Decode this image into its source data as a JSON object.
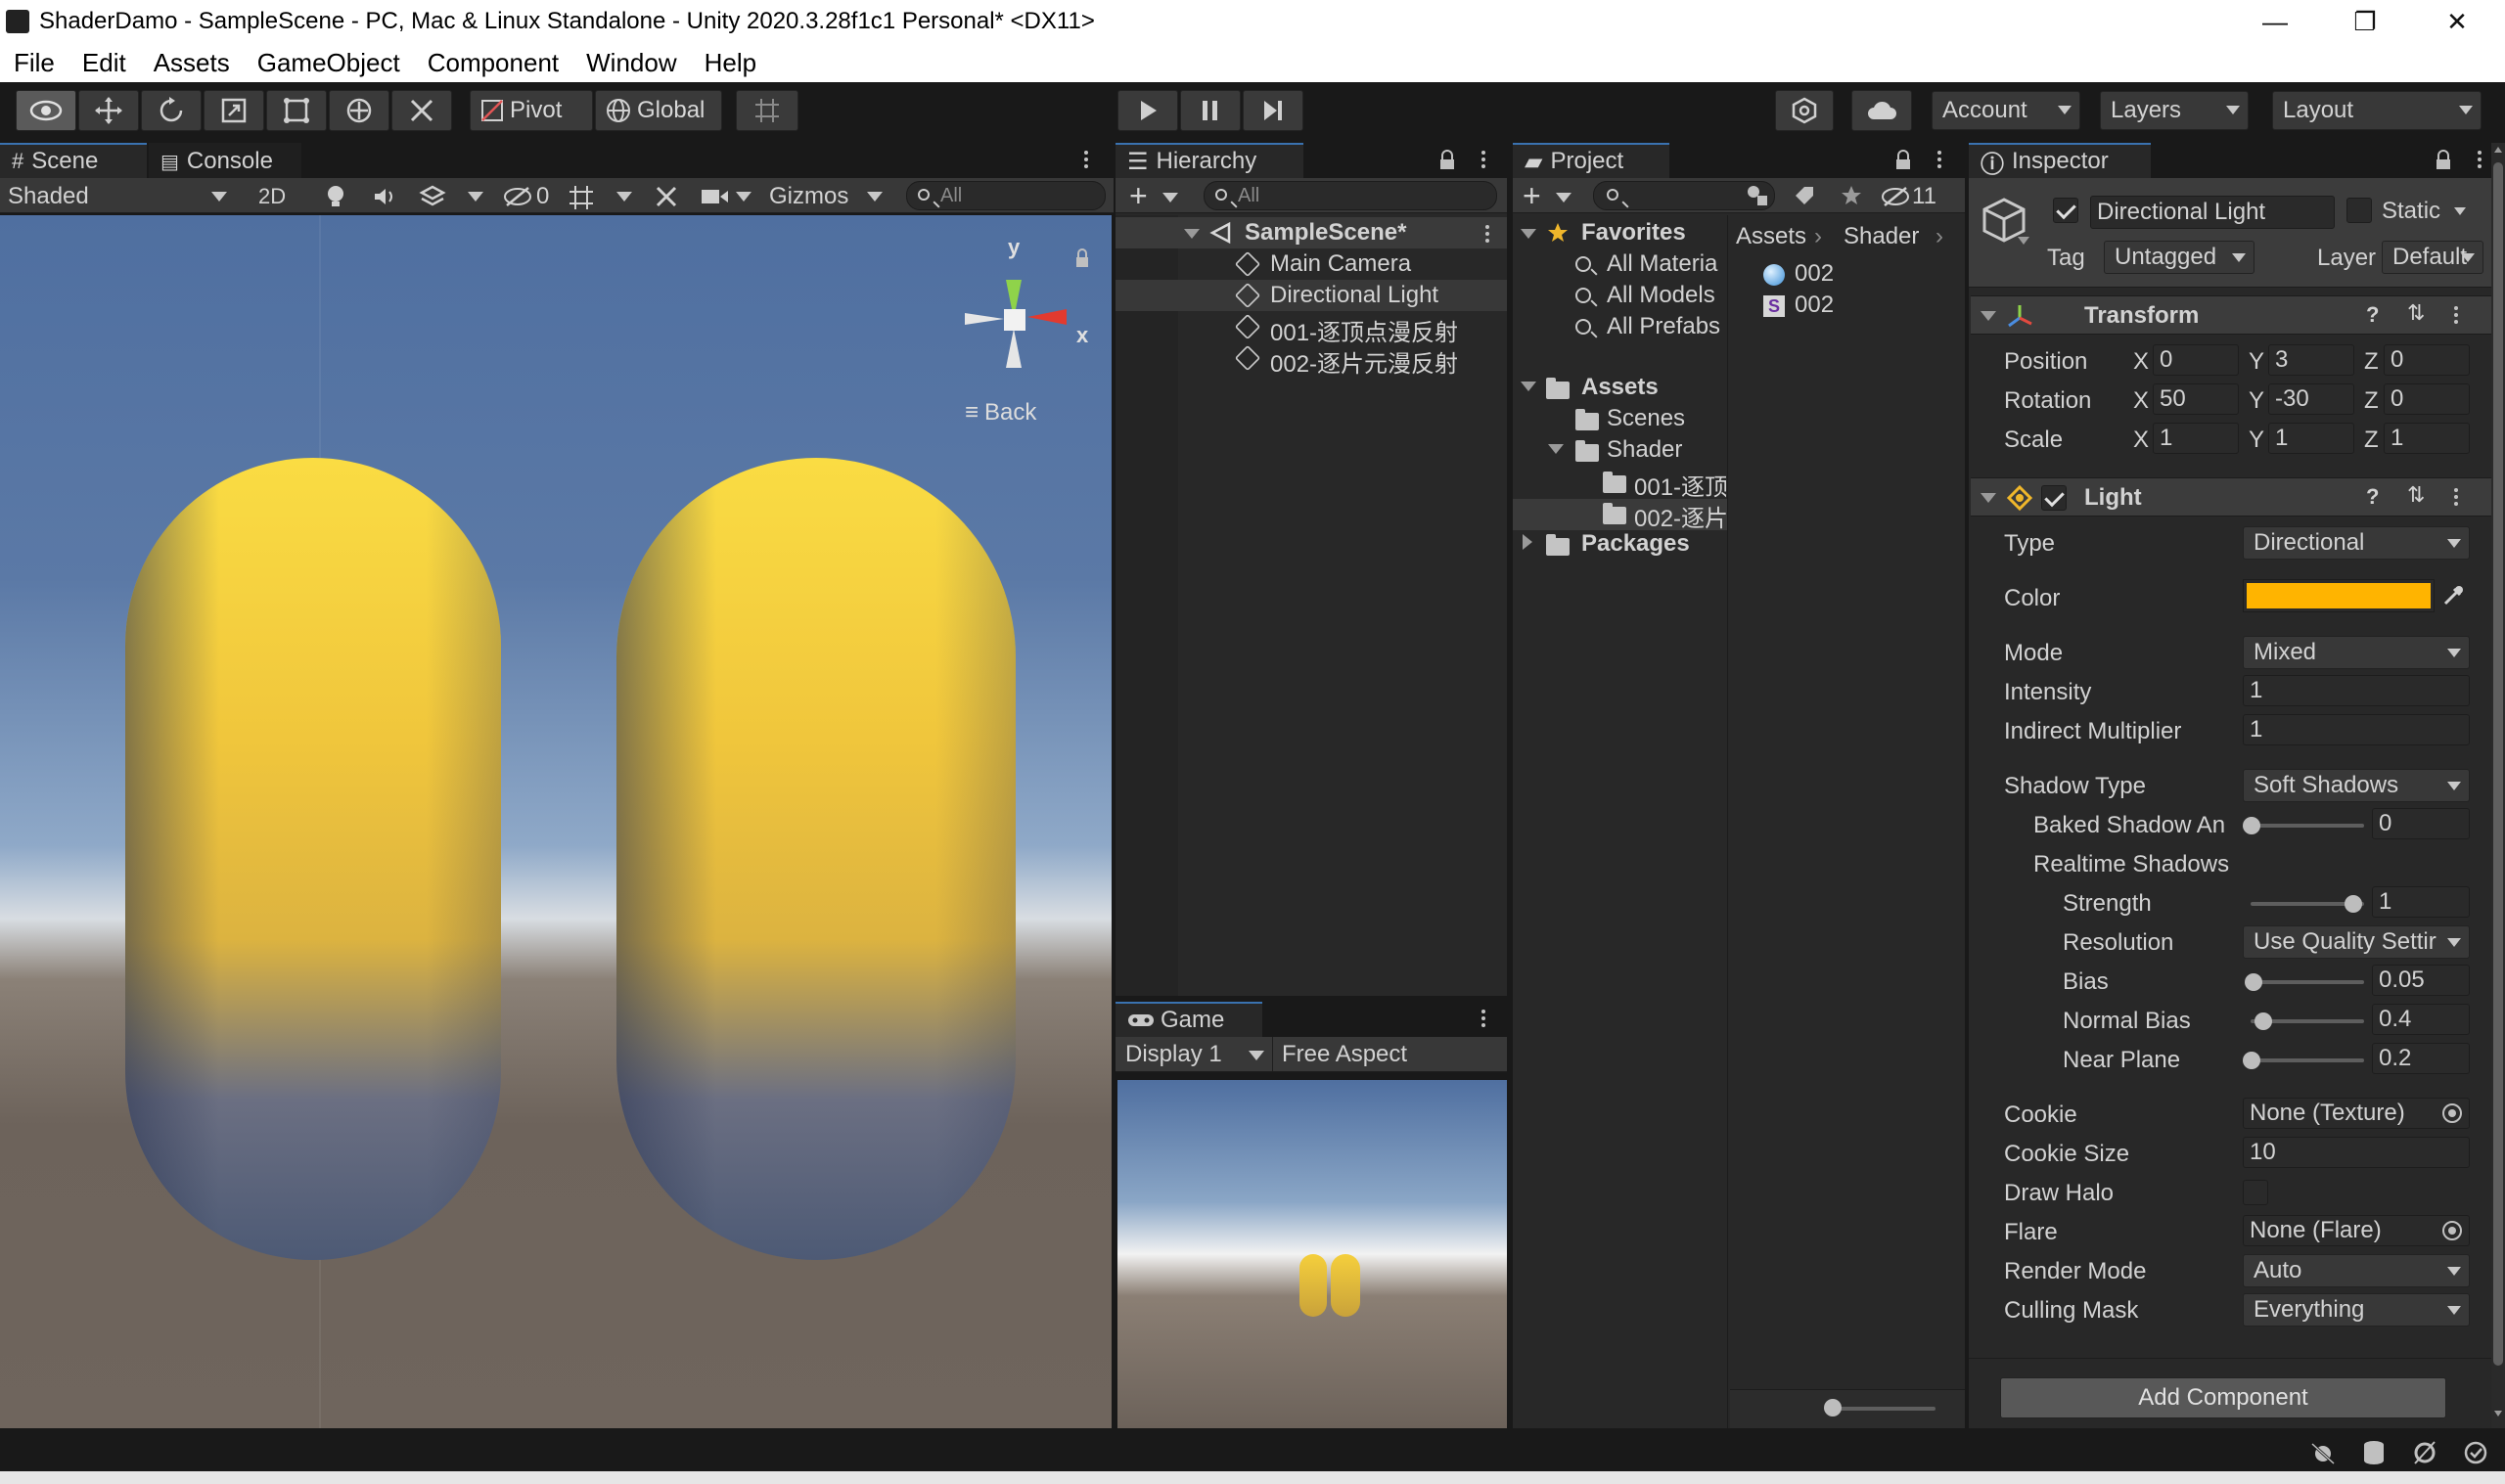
{
  "window": {
    "title": "ShaderDamo - SampleScene - PC, Mac & Linux Standalone - Unity 2020.3.28f1c1 Personal* <DX11>",
    "minimize": "—",
    "maximize": "❐",
    "close": "✕"
  },
  "menu": [
    "File",
    "Edit",
    "Assets",
    "GameObject",
    "Component",
    "Window",
    "Help"
  ],
  "toolbar": {
    "pivot": "Pivot",
    "global": "Global",
    "account": "Account",
    "layers": "Layers",
    "layout": "Layout"
  },
  "scene": {
    "tabs": [
      "Scene",
      "Console"
    ],
    "shading": "Shaded",
    "mode_2d": "2D",
    "hidden_count": "0",
    "gizmos": "Gizmos",
    "search_placeholder": "All",
    "gizmo_y": "y",
    "gizmo_x": "x",
    "view_label": "Back",
    "colors": {
      "capsule": "#f2c53a",
      "sky_top": "#4e6fa0",
      "ground": "#6d625a"
    }
  },
  "hierarchy": {
    "tab": "Hierarchy",
    "search_placeholder": "All",
    "scene": "SampleScene*",
    "items": [
      "Main Camera",
      "Directional Light",
      "001-逐顶点漫反射",
      "002-逐片元漫反射"
    ]
  },
  "game": {
    "tab": "Game",
    "display": "Display 1",
    "aspect": "Free Aspect"
  },
  "project": {
    "tab": "Project",
    "hidden_count": "11",
    "favorites": "Favorites",
    "favorites_items": [
      "All Materia",
      "All Models",
      "All Prefabs"
    ],
    "assets": "Assets",
    "assets_items": [
      "Scenes",
      "Shader"
    ],
    "shader_items": [
      "001-逐顶",
      "002-逐片"
    ],
    "packages": "Packages",
    "breadcrumb": [
      "Assets",
      "Shader"
    ],
    "files": [
      "002",
      "002"
    ]
  },
  "inspector": {
    "tab": "Inspector",
    "object_name": "Directional Light",
    "static_label": "Static",
    "tag_label": "Tag",
    "tag_value": "Untagged",
    "layer_label": "Layer",
    "layer_value": "Default",
    "transform": {
      "title": "Transform",
      "position_label": "Position",
      "rotation_label": "Rotation",
      "scale_label": "Scale",
      "position": [
        "0",
        "3",
        "0"
      ],
      "rotation": [
        "50",
        "-30",
        "0"
      ],
      "scale": [
        "1",
        "1",
        "1"
      ],
      "axes": [
        "X",
        "Y",
        "Z"
      ]
    },
    "light": {
      "title": "Light",
      "type_label": "Type",
      "type_value": "Directional",
      "color_label": "Color",
      "color_value": "#ffb400",
      "mode_label": "Mode",
      "mode_value": "Mixed",
      "intensity_label": "Intensity",
      "intensity_value": "1",
      "indirect_label": "Indirect Multiplier",
      "indirect_value": "1",
      "shadow_type_label": "Shadow Type",
      "shadow_type_value": "Soft Shadows",
      "baked_shadow_label": "Baked Shadow An",
      "baked_shadow_value": "0",
      "realtime_label": "Realtime Shadows",
      "strength_label": "Strength",
      "strength_value": "1",
      "resolution_label": "Resolution",
      "resolution_value": "Use Quality Settir",
      "bias_label": "Bias",
      "bias_value": "0.05",
      "normal_bias_label": "Normal Bias",
      "normal_bias_value": "0.4",
      "near_plane_label": "Near Plane",
      "near_plane_value": "0.2",
      "cookie_label": "Cookie",
      "cookie_value": "None (Texture)",
      "cookie_size_label": "Cookie Size",
      "cookie_size_value": "10",
      "draw_halo_label": "Draw Halo",
      "flare_label": "Flare",
      "flare_value": "None (Flare)",
      "render_mode_label": "Render Mode",
      "render_mode_value": "Auto",
      "culling_label": "Culling Mask",
      "culling_value": "Everything"
    },
    "add_component": "Add Component"
  }
}
